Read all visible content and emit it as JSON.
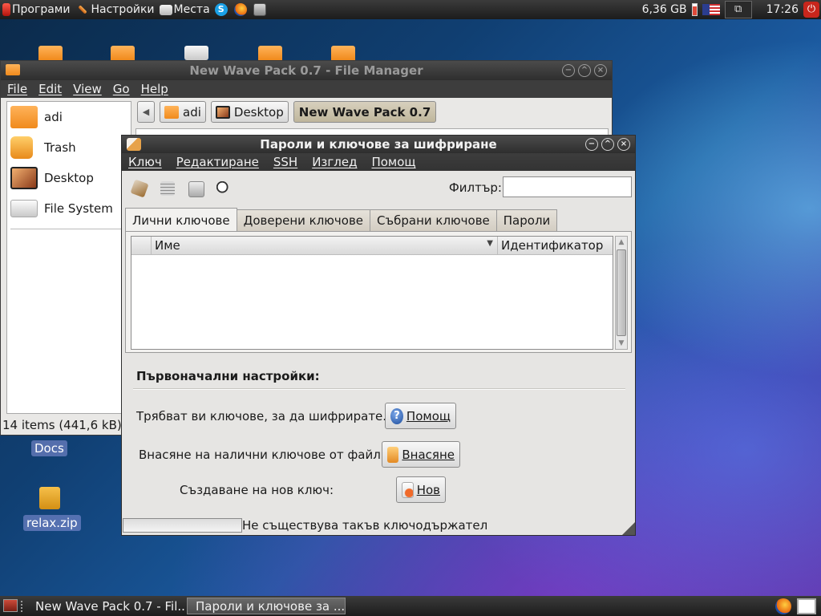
{
  "top_panel": {
    "applications": "Програми",
    "settings": "Настройки",
    "places": "Места",
    "disk_free": "6,36 GB",
    "clock": "17:26"
  },
  "desktop": {
    "docs_label": "Docs",
    "zip_label": "relax.zip"
  },
  "file_manager": {
    "title": "New Wave Pack 0.7 - File Manager",
    "menu": [
      "File",
      "Edit",
      "View",
      "Go",
      "Help"
    ],
    "sidebar": [
      "adi",
      "Trash",
      "Desktop",
      "File System"
    ],
    "path": [
      "adi",
      "Desktop",
      "New Wave Pack 0.7"
    ],
    "status": "14 items (441,6 kB), F"
  },
  "dialog": {
    "title": "Пароли и ключове за шифриране",
    "menu": [
      "Ключ",
      "Редактиране",
      "SSH",
      "Изглед",
      "Помощ"
    ],
    "filter_label": "Филтър:",
    "filter_value": "",
    "tabs": [
      "Лични ключове",
      "Доверени ключове",
      "Събрани ключове",
      "Пароли"
    ],
    "columns": [
      "Име",
      "Идентификатор"
    ],
    "section_title": "Първоначални настройки:",
    "rows": [
      {
        "text": "Трябват ви ключове, за да шифрирате.",
        "button": "Помощ"
      },
      {
        "text": "Внасяне на налични ключове от файл:",
        "button": "Внасяне"
      },
      {
        "text": "Създаване на нов ключ:",
        "button": "Нов"
      }
    ],
    "status": "Не съществува такъв ключодържател"
  },
  "taskbar": {
    "tasks": [
      "New Wave Pack 0.7 - Fil...",
      "Пароли и ключове за ..."
    ]
  }
}
